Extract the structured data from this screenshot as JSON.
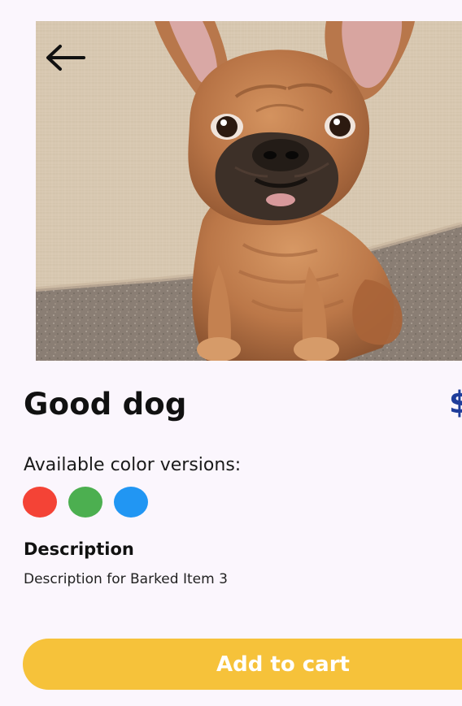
{
  "product": {
    "title": "Good dog",
    "price": "$"
  },
  "colors": {
    "label": "Available color versions:",
    "options": [
      {
        "name": "red",
        "hex": "#f44336"
      },
      {
        "name": "green",
        "hex": "#4caf50"
      },
      {
        "name": "blue",
        "hex": "#2196f3"
      }
    ]
  },
  "description": {
    "title": "Description",
    "text": "Description for Barked Item 3"
  },
  "actions": {
    "add_to_cart": "Add to cart"
  }
}
